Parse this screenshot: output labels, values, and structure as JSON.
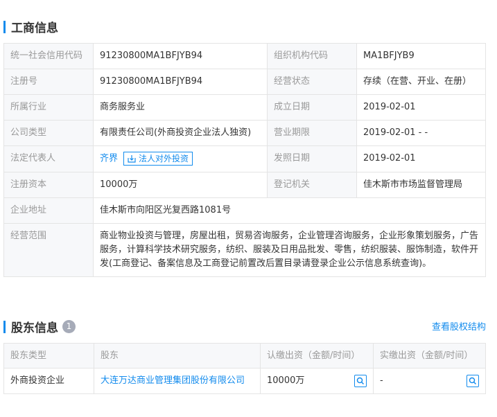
{
  "business": {
    "title": "工商信息",
    "rows": [
      [
        "统一社会信用代码",
        "91230800MA1BFJYB94",
        "组织机构代码",
        "MA1BFJYB9"
      ],
      [
        "注册号",
        "91230800MA1BFJYB94",
        "经营状态",
        "存续（在营、开业、在册）"
      ],
      [
        "所属行业",
        "商务服务业",
        "成立日期",
        "2019-02-01"
      ],
      [
        "公司类型",
        "有限责任公司(外商投资企业法人独资)",
        "营业期限",
        "2019-02-01 - -"
      ],
      [
        "法定代表人",
        "齐界",
        "发照日期",
        "2019-02-01"
      ],
      [
        "注册资本",
        "10000万",
        "登记机关",
        "佳木斯市市场监督管理局"
      ]
    ],
    "legal_rep_button": "法人对外投资",
    "address_label": "企业地址",
    "address": "佳木斯市向阳区光复西路1081号",
    "scope_label": "经营范围",
    "scope": "商业物业投资与管理，房屋出租，贸易咨询服务，企业管理咨询服务，企业形象策划服务，广告服务，计算科学技术研究服务，纺织、服装及日用品批发、零售，纺织服装、服饰制造，软件开发(工商登记、备案信息及工商登记前置改后置目录请登录企业公示信息系统查询)。"
  },
  "shareholders": {
    "title": "股东信息",
    "count": "1",
    "view_link": "查看股权结构",
    "headers": [
      "股东类型",
      "股东",
      "认缴出资（金额/时间）",
      "实缴出资（金额/时间）"
    ],
    "rows": [
      {
        "type": "外商投资企业",
        "name": "大连万达商业管理集团股份有限公司",
        "subscribed": "10000万",
        "paid": "-"
      }
    ]
  },
  "colors": {
    "accent": "#128bed"
  }
}
